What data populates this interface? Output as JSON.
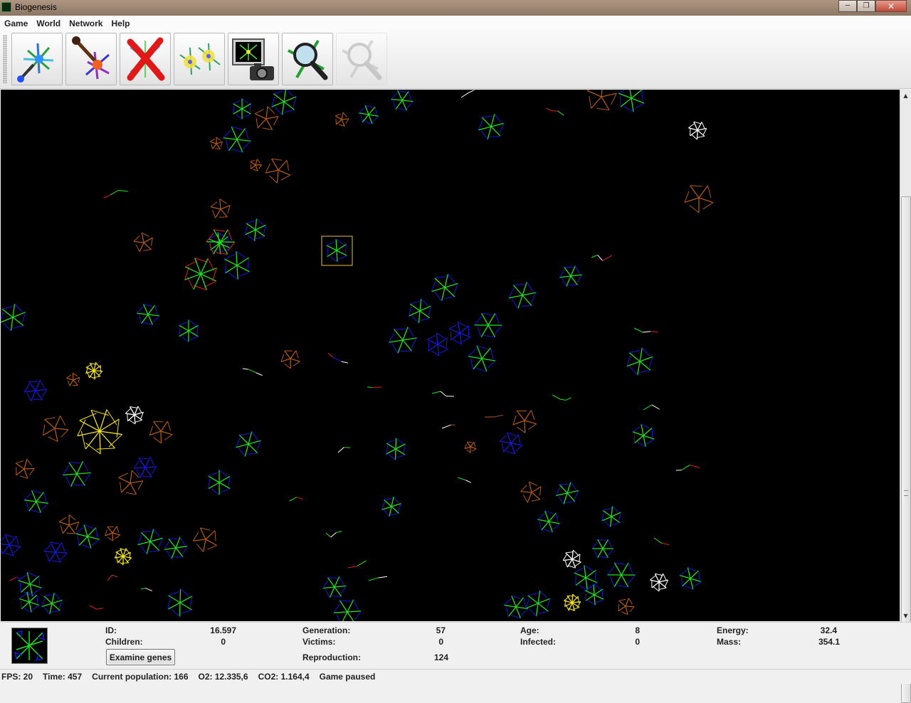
{
  "window": {
    "title": "Biogenesis",
    "icon": "biogenesis-app-icon",
    "controls": [
      "minimize-icon",
      "maximize-icon",
      "close-icon"
    ]
  },
  "menu": [
    "Game",
    "World",
    "Network",
    "Help"
  ],
  "toolbar": {
    "tools": [
      {
        "icon": "new-organism-icon",
        "enabled": true
      },
      {
        "icon": "manipulate-organism-icon",
        "enabled": true
      },
      {
        "icon": "kill-organism-icon",
        "enabled": true
      },
      {
        "icon": "reproduce-organism-icon",
        "enabled": true
      },
      {
        "icon": "save-image-icon",
        "enabled": true
      },
      {
        "icon": "track-organism-icon",
        "enabled": true
      },
      {
        "icon": "stop-tracking-icon",
        "enabled": false
      }
    ]
  },
  "info": {
    "id_label": "ID:",
    "id_value": "16.597",
    "children_label": "Children:",
    "children_value": "0",
    "generation_label": "Generation:",
    "generation_value": "57",
    "victims_label": "Victims:",
    "victims_value": "0",
    "reproduction_label": "Reproduction:",
    "reproduction_value": "124",
    "age_label": "Age:",
    "age_value": "8",
    "infected_label": "Infected:",
    "infected_value": "0",
    "energy_label": "Energy:",
    "energy_value": "32.4",
    "mass_label": "Mass:",
    "mass_value": "354.1",
    "examine_button": "Examine genes"
  },
  "status": {
    "fps": "FPS: 20",
    "time": "Time: 457",
    "population": "Current population: 166",
    "o2": "O2: 12.335,6",
    "co2": "CO2: 1.164,4",
    "state": "Game paused"
  },
  "colors": {
    "world_background": "#000000",
    "selection_box": "#e8c040",
    "organism_green": "#20e020",
    "organism_blue": "#1818e0",
    "organism_brown": "#b05818",
    "organism_white": "#ffffff",
    "organism_yellow": "#f0e020",
    "organism_red": "#e02020"
  },
  "scrollbar": {
    "position": 0.02
  }
}
